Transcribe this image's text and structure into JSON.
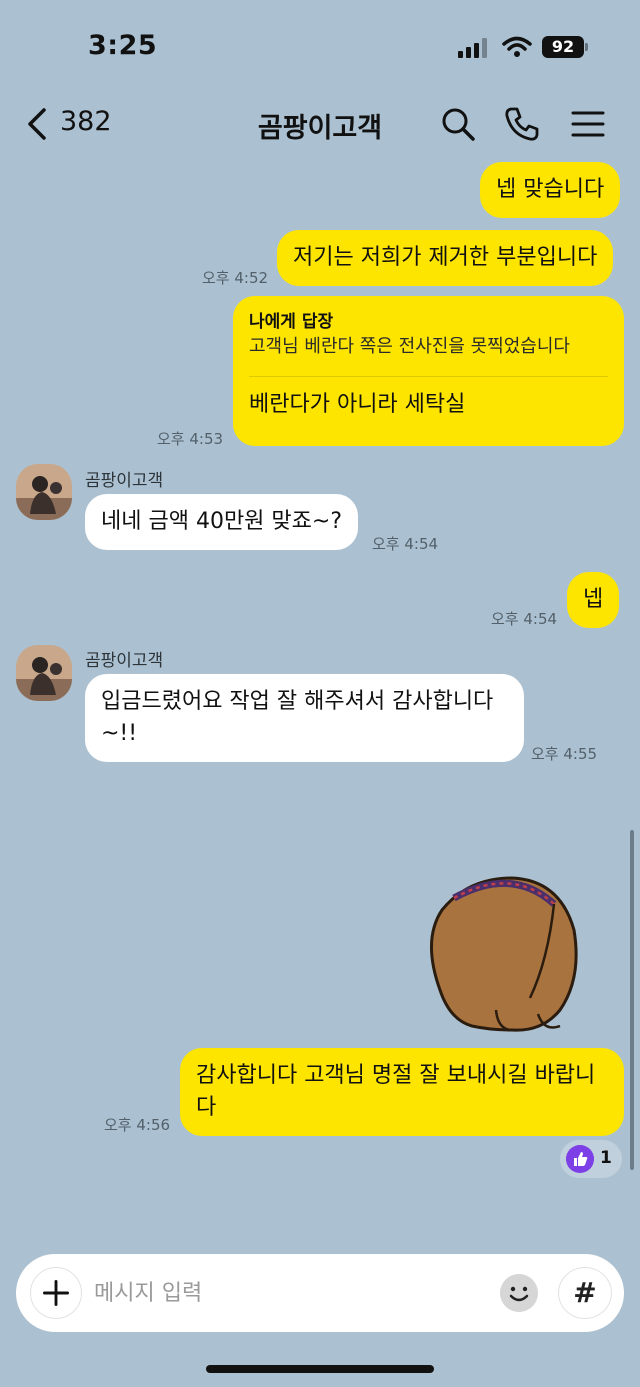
{
  "status_bar": {
    "time": "3:25",
    "battery": "92"
  },
  "header": {
    "back_count": "382",
    "title": "곰팡이고객"
  },
  "messages": [
    {
      "text": "넵 맞습니다"
    },
    {
      "text": "저기는 저희가 제거한 부분입니다",
      "time": "오후 4:52"
    },
    {
      "reply_header": "나에게 답장",
      "reply_quote": "고객님 베란다 쪽은 전사진을 못찍었습니다",
      "text": "베란다가 아니라 세탁실",
      "time": "오후 4:53"
    },
    {
      "sender": "곰팡이고객",
      "text": "네네 금액 40만원 맞죠~?",
      "time": "오후 4:54"
    },
    {
      "text": "넵",
      "time": "오후 4:54"
    },
    {
      "sender": "곰팡이고객",
      "line1": "입금드렸어요 작업 잘 해주셔서 감사합니다",
      "line2": "~!!",
      "time": "오후 4:55"
    },
    {
      "line1": "감사합니다 고객님 명절 잘 보내시길 바랍니",
      "line2": "다",
      "time": "오후 4:56",
      "reaction_count": "1"
    }
  ],
  "input": {
    "placeholder": "메시지 입력",
    "hash_label": "#"
  },
  "colors": {
    "background": "#abc1d1",
    "my_bubble": "#fee500",
    "other_bubble": "#ffffff",
    "reaction": "#7d3fe6"
  }
}
